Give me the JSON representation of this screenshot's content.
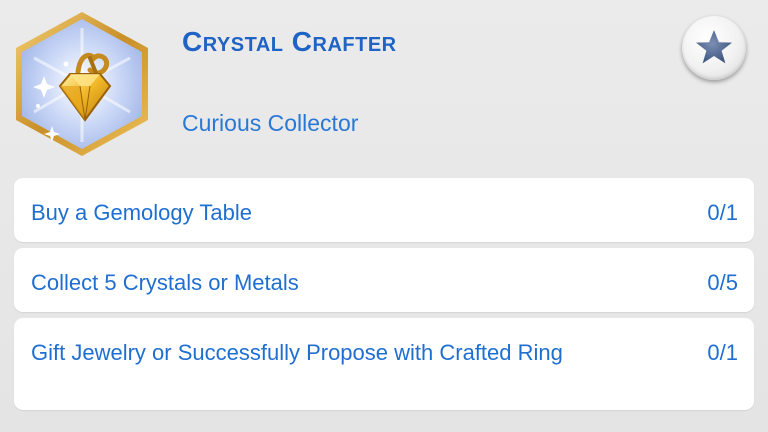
{
  "aspiration": {
    "title": "Crystal Crafter",
    "category": "Curious Collector",
    "badge_icon": "crystal-necklace-icon",
    "colors": {
      "title": "#1f63c4",
      "text": "#2a78d6",
      "badge_border": "#d9a640",
      "badge_fill": "#b9c9f0"
    }
  },
  "favorite_button": {
    "icon": "star-icon"
  },
  "milestones": [
    {
      "label": "Buy a Gemology Table",
      "progress": "0/1"
    },
    {
      "label": "Collect 5 Crystals or Metals",
      "progress": "0/5"
    },
    {
      "label": "Gift Jewelry or Successfully Propose with Crafted Ring",
      "progress": "0/1"
    }
  ]
}
